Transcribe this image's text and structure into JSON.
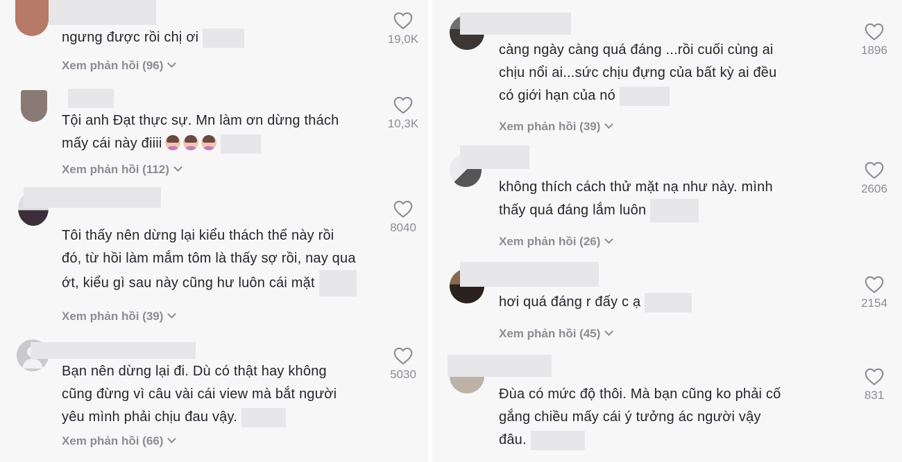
{
  "left_comments": [
    {
      "text": "ngưng được rồi chị ơi",
      "likes": "19,0K",
      "replies": "Xem phản hồi (96)"
    },
    {
      "lines": [
        "Tội anh Đạt thực sự. Mn làm ơn dừng thách",
        "mấy cái này điiii"
      ],
      "emojis": 3,
      "likes": "10,3K",
      "replies": "Xem phản hồi (112)"
    },
    {
      "lines": [
        "Tôi thấy nên dừng lại kiểu thách thế này rồi",
        "đó, từ hồi làm mắm tôm là thấy sợ rồi, nay qua",
        "ớt, kiểu gì sau này cũng hư luôn cái mặt"
      ],
      "likes": "8040",
      "replies": "Xem phản hồi (39)"
    },
    {
      "lines": [
        "Bạn nên dừng lại đi. Dù có thật hay không",
        "cũng đừng vì câu vài cái view mà bắt người",
        "yêu mình phải chịu đau vậy."
      ],
      "likes": "5030",
      "replies": "Xem phản hồi (66)"
    }
  ],
  "right_comments": [
    {
      "lines": [
        "càng ngày càng quá đáng ...rồi cuối cùng ai",
        "chịu nổi ai...sức chịu đựng của bất kỳ ai đều",
        "có giới hạn của nó"
      ],
      "likes": "1896",
      "replies": "Xem phản hồi (39)"
    },
    {
      "lines": [
        "không thích cách thử mặt nạ như này. mình",
        "thấy quá đáng lắm luôn"
      ],
      "likes": "2606",
      "replies": "Xem phản hồi (26)"
    },
    {
      "lines": [
        "hơi quá đáng r đấy c ạ"
      ],
      "likes": "2154",
      "replies": "Xem phản hồi (45)"
    },
    {
      "lines": [
        "Đùa có mức độ thôi. Mà bạn cũng ko phải cố",
        "gắng chiều mấy cái ý tưởng ác người vậy",
        "đâu."
      ],
      "likes": "831"
    }
  ],
  "icons": {
    "like": "heart-outline-icon",
    "expand": "chevron-down-icon",
    "avatar": "user-avatar"
  },
  "colors": {
    "text": "#25252b",
    "muted": "#8c8c92",
    "background": "#f7f7f8"
  }
}
